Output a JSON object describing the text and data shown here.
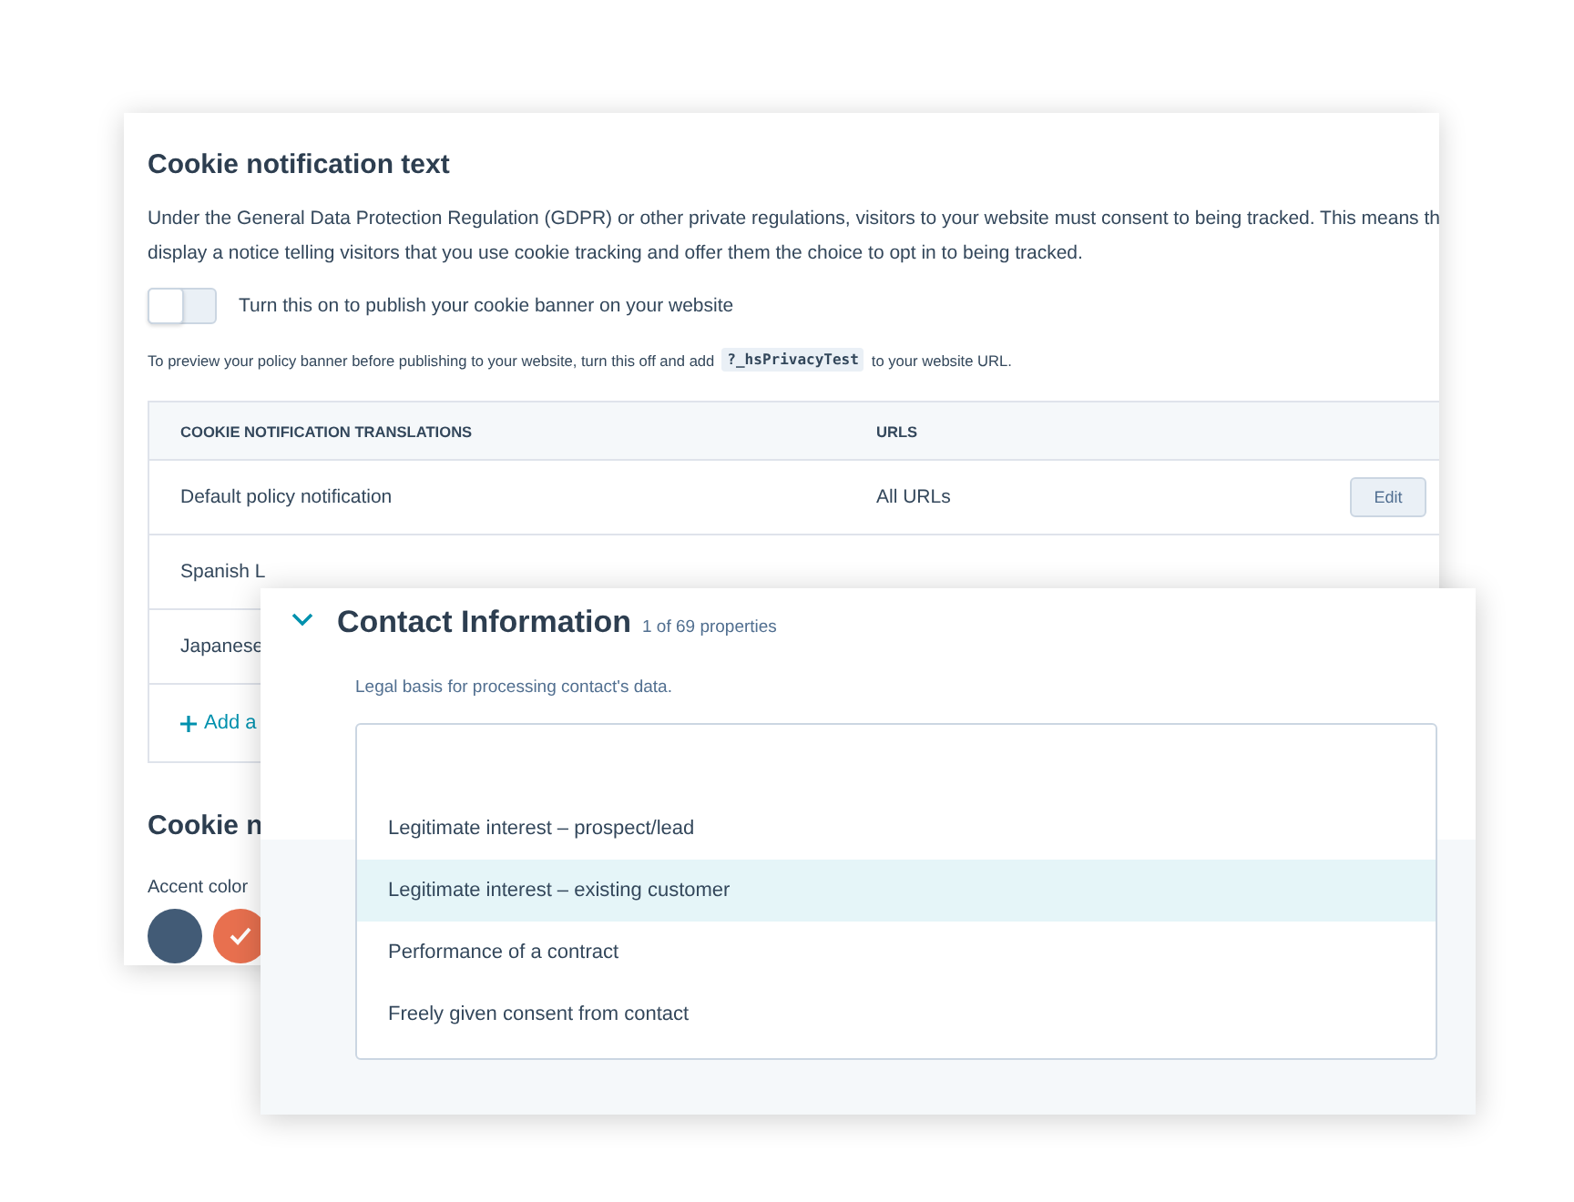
{
  "cookie_card": {
    "title": "Cookie notification text",
    "description_lines": [
      "Under the General Data Protection Regulation (GDPR) or other private regulations, visitors to your website must consent to being tracked. This means th",
      "display a notice telling visitors that you use cookie tracking and offer them the choice to opt in to being tracked."
    ],
    "publish_toggle": {
      "label": "Turn this on to publish your cookie banner on your website",
      "on": false
    },
    "preview_note": {
      "before": "To preview your policy banner before publishing to your website, turn this off and add",
      "code": "?_hsPrivacyTest",
      "after": "to your website URL."
    },
    "table": {
      "columns": [
        "COOKIE NOTIFICATION TRANSLATIONS",
        "URLS"
      ],
      "rows": [
        {
          "name": "Default policy notification",
          "urls": "All URLs",
          "action": "Edit"
        },
        {
          "name": "Spanish L"
        },
        {
          "name": "Japanese"
        }
      ],
      "add_link": "Add a"
    },
    "style_title": "Cookie n",
    "accent_label": "Accent color",
    "swatches": [
      {
        "color": "#425b76",
        "selected": false
      },
      {
        "color": "#e8704f",
        "selected": true
      }
    ]
  },
  "contact_card": {
    "title": "Contact Information",
    "expanded": true,
    "count": "1 of 69 properties",
    "field_label": "Legal basis for processing contact's data.",
    "options": [
      {
        "label": "Legitimate interest – prospect/lead",
        "selected": false
      },
      {
        "label": "Legitimate interest – existing customer",
        "selected": true
      },
      {
        "label": "Performance of a contract",
        "selected": false
      },
      {
        "label": "Freely given consent from contact",
        "selected": false
      }
    ]
  }
}
